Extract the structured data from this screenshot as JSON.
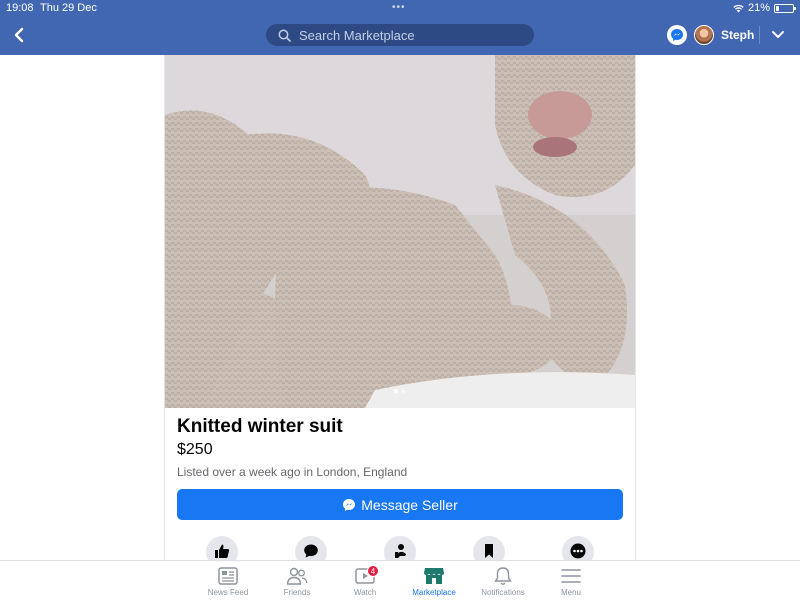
{
  "status_bar": {
    "time": "19:08",
    "date": "Thu 29 Dec",
    "dots": "•••",
    "battery_text": "21%",
    "battery_level": 0.21
  },
  "header": {
    "search_placeholder": "Search Marketplace",
    "user_name": "Steph",
    "icons": [
      "back-arrow-icon",
      "search-icon",
      "messenger-icon",
      "chevron-down-icon"
    ]
  },
  "listing": {
    "title": "Knitted winter suit",
    "price": "$250",
    "meta": "Listed over a week ago in London, England",
    "message_button_label": "Message Seller",
    "photo_count": 2,
    "photo_index": 1,
    "actions": [
      "like-icon",
      "comment-icon",
      "share-icon",
      "save-icon",
      "more-icon"
    ]
  },
  "tabbar": {
    "tabs": [
      {
        "label": "News Feed",
        "icon": "news-feed-icon",
        "active": false
      },
      {
        "label": "Friends",
        "icon": "friends-icon",
        "active": false
      },
      {
        "label": "Watch",
        "icon": "watch-icon",
        "active": false,
        "badge": "4"
      },
      {
        "label": "Marketplace",
        "icon": "marketplace-icon",
        "active": true
      },
      {
        "label": "Notifications",
        "icon": "bell-icon",
        "active": false
      },
      {
        "label": "Menu",
        "icon": "menu-icon",
        "active": false
      }
    ]
  },
  "colors": {
    "header_bg": "#4267b2",
    "accent": "#1877f2",
    "badge": "#e41e3f"
  }
}
